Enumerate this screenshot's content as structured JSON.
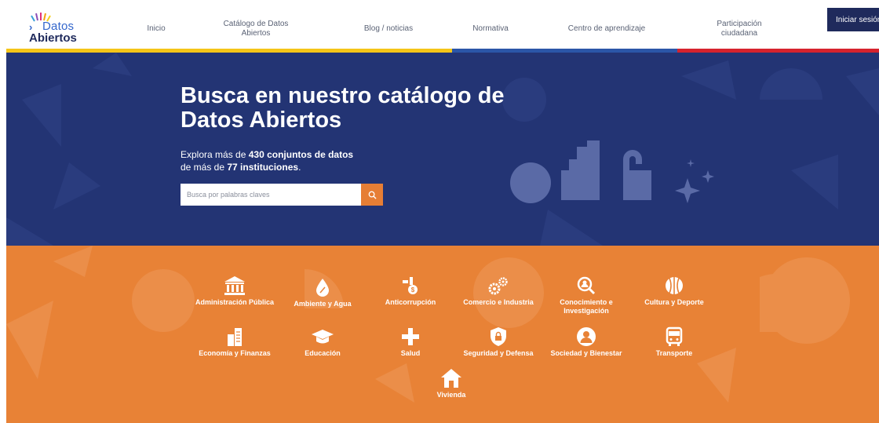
{
  "header": {
    "logo": {
      "line1": "Datos",
      "line2": "Abiertos"
    },
    "nav": [
      {
        "label": "Inicio"
      },
      {
        "label": "Catálogo de Datos Abiertos"
      },
      {
        "label": "Blog / noticias"
      },
      {
        "label": "Normativa"
      },
      {
        "label": "Centro de aprendizaje"
      },
      {
        "label": "Participación ciudadana"
      }
    ],
    "login_label": "Iniciar sesión"
  },
  "colors": {
    "hero_bg": "#233474",
    "categories_bg": "#e88236",
    "stripe_yellow": "#f5c518",
    "stripe_blue": "#2b56a8",
    "stripe_red": "#d6232e",
    "accent_orange": "#e67e35"
  },
  "hero": {
    "title": "Busca en nuestro catálogo de Datos Abiertos",
    "sub_prefix": "Explora más de ",
    "datasets": "430 conjuntos de datos",
    "sub_mid": "de más de ",
    "institutions": "77 instituciones",
    "sub_end": ".",
    "search_placeholder": "Busca por palabras claves",
    "search_icon": "search-icon"
  },
  "categories": [
    {
      "label": "Administración Pública",
      "icon": "institution-icon"
    },
    {
      "label": "Ambiente y Agua",
      "icon": "water-drop-icon"
    },
    {
      "label": "Anticorrupción",
      "icon": "money-hand-icon"
    },
    {
      "label": "Comercio e Industria",
      "icon": "gears-icon"
    },
    {
      "label": "Conocimiento e Investigación",
      "icon": "magnifier-person-icon"
    },
    {
      "label": "Cultura y Deporte",
      "icon": "ball-icon"
    },
    {
      "label": "Economía y Finanzas",
      "icon": "building-chart-icon"
    },
    {
      "label": "Educación",
      "icon": "graduation-cap-icon"
    },
    {
      "label": "Salud",
      "icon": "health-cross-icon"
    },
    {
      "label": "Seguridad y Defensa",
      "icon": "shield-lock-icon"
    },
    {
      "label": "Sociedad y Bienestar",
      "icon": "person-icon"
    },
    {
      "label": "Transporte",
      "icon": "bus-icon"
    },
    {
      "label": "Vivienda",
      "icon": "house-icon"
    }
  ]
}
